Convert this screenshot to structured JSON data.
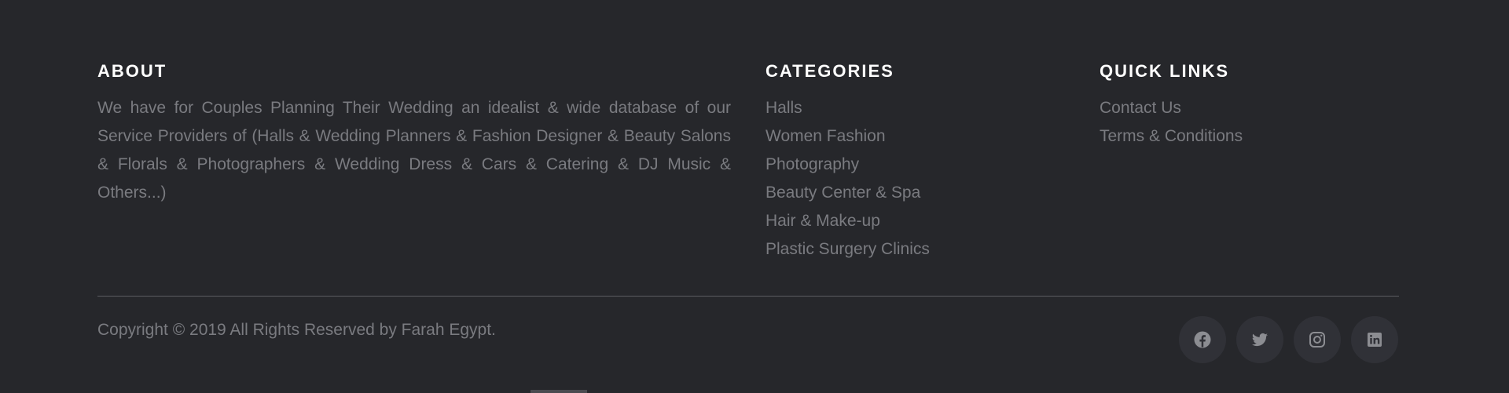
{
  "about": {
    "title": "ABOUT",
    "text": "We have for Couples Planning Their Wedding an idealist & wide database of our Service Providers of (Halls & Wedding Planners & Fashion Designer & Beauty Salons & Florals & Photographers & Wedding Dress & Cars & Catering & DJ Music & Others...)"
  },
  "categories": {
    "title": "CATEGORIES",
    "items": [
      {
        "label": "Halls"
      },
      {
        "label": "Women Fashion"
      },
      {
        "label": "Photography"
      },
      {
        "label": "Beauty Center & Spa"
      },
      {
        "label": "Hair & Make-up"
      },
      {
        "label": "Plastic Surgery Clinics"
      }
    ]
  },
  "quick_links": {
    "title": "QUICK LINKS",
    "items": [
      {
        "label": "Contact Us"
      },
      {
        "label": "Terms & Conditions"
      }
    ]
  },
  "copyright": "Copyright © 2019 All Rights Reserved by Farah Egypt.",
  "social": [
    {
      "icon": "facebook-icon"
    },
    {
      "icon": "twitter-icon"
    },
    {
      "icon": "instagram-icon"
    },
    {
      "icon": "linkedin-icon"
    }
  ],
  "colors": {
    "background": "#26272b",
    "heading": "#ffffff",
    "text": "#7a7b80",
    "social_bg": "#303137",
    "icon": "#8c8d92"
  }
}
